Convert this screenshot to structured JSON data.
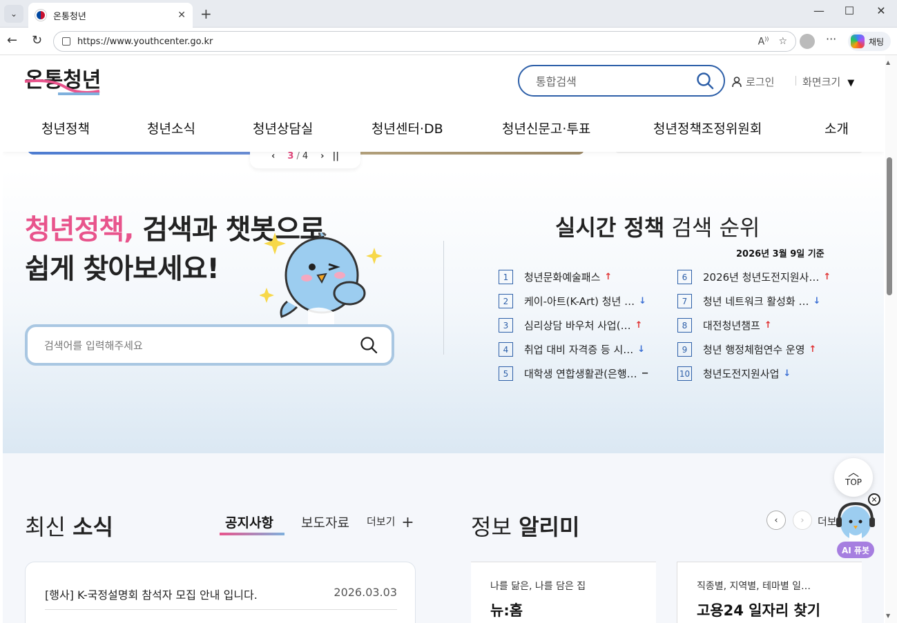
{
  "browser": {
    "tab_title": "온통청년",
    "url": "https://www.youthcenter.go.kr",
    "copilot_label": "채팅"
  },
  "header": {
    "logo_text": "온통청년",
    "search_placeholder": "통합검색",
    "login": "로그인",
    "font_size": "화면크기",
    "nav": [
      "청년정책",
      "청년소식",
      "청년상담실",
      "청년센터·DB",
      "청년신문고·투표",
      "청년정책조정위원회",
      "소개"
    ]
  },
  "banner": {
    "current": "3",
    "separator": "/",
    "total": "4"
  },
  "hero": {
    "title_pink": "청년정책,",
    "title_rest": " 검색과 챗봇으로",
    "title_line2": "쉽게 찾아보세요!",
    "search_placeholder": "검색어를 입력해주세요"
  },
  "ranking": {
    "title_bold": "실시간 정책",
    "title_rest": " 검색 순위",
    "date": "2026년 3월 9일 기준",
    "items": [
      {
        "num": "1",
        "text": "청년문화예술패스",
        "trend": "up"
      },
      {
        "num": "2",
        "text": "케이-아트(K-Art) 청년 …",
        "trend": "down"
      },
      {
        "num": "3",
        "text": "심리상담 바우처 사업(…",
        "trend": "up"
      },
      {
        "num": "4",
        "text": "취업 대비 자격증 등 시…",
        "trend": "down"
      },
      {
        "num": "5",
        "text": "대학생 연합생활관(은행…",
        "trend": "flat"
      },
      {
        "num": "6",
        "text": "2026년 청년도전지원사…",
        "trend": "up"
      },
      {
        "num": "7",
        "text": "청년 네트워크 활성화 …",
        "trend": "down"
      },
      {
        "num": "8",
        "text": "대전청년챔프",
        "trend": "up"
      },
      {
        "num": "9",
        "text": "청년 행정체험연수 운영",
        "trend": "up"
      },
      {
        "num": "10",
        "text": "청년도전지원사업",
        "trend": "down"
      }
    ],
    "trend_symbols": {
      "up": "↑",
      "down": "↓",
      "flat": "−"
    }
  },
  "news": {
    "title_light": "최신 ",
    "title_bold": "소식",
    "tab_notice": "공지사항",
    "tab_press": "보도자료",
    "more": "더보기",
    "items": [
      {
        "title": "[행사] K-국정설명회 참석자 모집 안내 입니다.",
        "date": "2026.03.03"
      }
    ]
  },
  "info": {
    "title_light": "정보 ",
    "title_bold": "알리미",
    "more": "더보기",
    "cards": [
      {
        "sub": "나를 닮은, 나를 담은 집",
        "main": "뉴:홈"
      },
      {
        "sub": "직종별, 지역별, 테마별 일…",
        "main": "고용24 일자리 찾기"
      }
    ]
  },
  "floating": {
    "top": "TOP",
    "ai_label": "AI 퓨봇"
  },
  "colors": {
    "accent_blue": "#2d5fa8",
    "accent_pink": "#e8548c",
    "up": "#e03131",
    "down": "#3b6fd4"
  }
}
